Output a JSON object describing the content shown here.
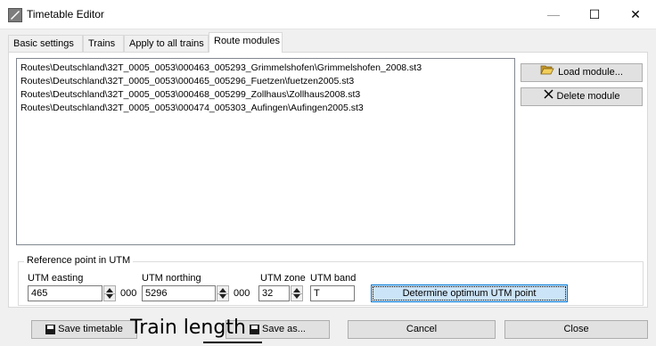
{
  "window": {
    "title": "Timetable Editor",
    "minimize_glyph": "—",
    "maximize_glyph": "☐",
    "close_glyph": "✕"
  },
  "tabs": [
    {
      "label": "Basic settings",
      "active": false
    },
    {
      "label": "Trains",
      "active": false
    },
    {
      "label": "Apply to all trains",
      "active": false
    },
    {
      "label": "Route modules",
      "active": true
    }
  ],
  "modules": [
    "Routes\\Deutschland\\32T_0005_0053\\000463_005293_Grimmelshofen\\Grimmelshofen_2008.st3",
    "Routes\\Deutschland\\32T_0005_0053\\000465_005296_Fuetzen\\fuetzen2005.st3",
    "Routes\\Deutschland\\32T_0005_0053\\000468_005299_Zollhaus\\Zollhaus2008.st3",
    "Routes\\Deutschland\\32T_0005_0053\\000474_005303_Aufingen\\Aufingen2005.st3"
  ],
  "buttons": {
    "load_module": "Load module...",
    "delete_module": "Delete module",
    "determine": "Determine optimum UTM point",
    "save_timetable": "Save timetable",
    "save_as": "Save as...",
    "cancel": "Cancel",
    "close": "Close"
  },
  "utm": {
    "group_title": "Reference point in UTM",
    "easting_label": "UTM easting",
    "easting_value": "465",
    "easting_suffix": "000",
    "northing_label": "UTM northing",
    "northing_value": "5296",
    "northing_suffix": "000",
    "zone_label": "UTM zone",
    "zone_value": "32",
    "band_label": "UTM band",
    "band_value": "T"
  },
  "overlay": {
    "text": "Train length"
  },
  "icons": {
    "app": "timetable-editor-icon",
    "load": "folder-open-icon",
    "delete": "x-icon",
    "save": "floppy-disk-icon"
  }
}
